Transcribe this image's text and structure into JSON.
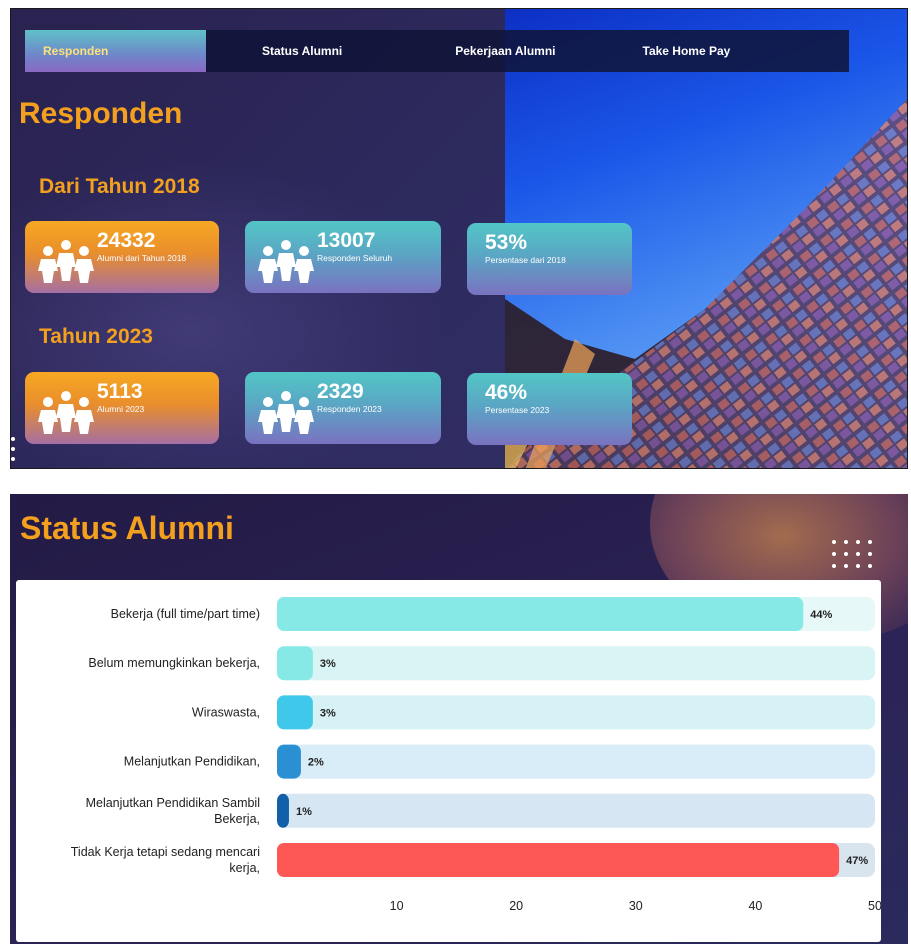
{
  "nav": {
    "items": [
      {
        "label": "Responden",
        "active": true
      },
      {
        "label": "Status Alumni",
        "active": false
      },
      {
        "label": "Pekerjaan Alumni",
        "active": false
      },
      {
        "label": "Take Home Pay",
        "active": false
      }
    ]
  },
  "responden": {
    "title": "Responden",
    "section_2018": {
      "title": "Dari Tahun 2018",
      "cards": [
        {
          "value": "24332",
          "label": "Alumni dari Tahun 2018",
          "icon": "people-icon",
          "color": "#f7a823"
        },
        {
          "value": "13007",
          "label": "Responden Seluruh",
          "icon": "people-icon",
          "color": "#52c6c6"
        },
        {
          "value": "53%",
          "label": "Persentase dari 2018",
          "color": "#52c6c6"
        }
      ]
    },
    "section_2023": {
      "title": "Tahun 2023",
      "cards": [
        {
          "value": "5113",
          "label": "Alumni 2023",
          "icon": "people-icon",
          "color": "#f7a823"
        },
        {
          "value": "2329",
          "label": "Responden 2023",
          "icon": "people-icon",
          "color": "#52c6c6"
        },
        {
          "value": "46%",
          "label": "Persentase 2023",
          "color": "#52c6c6"
        }
      ]
    }
  },
  "status_alumni": {
    "title": "Status Alumni"
  },
  "chart_data": {
    "type": "bar",
    "orientation": "horizontal",
    "categories": [
      "Bekerja (full time/part time)",
      "Belum memungkinkan bekerja,",
      "Wiraswasta,",
      "Melanjutkan Pendidikan,",
      "Melanjutkan Pendidikan Sambil Bekerja,",
      "Tidak Kerja tetapi sedang mencari kerja,"
    ],
    "category_lines": [
      [
        "Bekerja (full time/part time)"
      ],
      [
        "Belum memungkinkan bekerja,"
      ],
      [
        "Wiraswasta,"
      ],
      [
        "Melanjutkan Pendidikan,"
      ],
      [
        "Melanjutkan Pendidikan Sambil",
        "Bekerja,"
      ],
      [
        "Tidak Kerja tetapi sedang mencari",
        "kerja,"
      ]
    ],
    "values": [
      44,
      3,
      3,
      2,
      1,
      47
    ],
    "data_labels": [
      "44%",
      "3%",
      "3%",
      "2%",
      "1%",
      "47%"
    ],
    "bar_colors": [
      "#86e9e6",
      "#86e9e6",
      "#40c8ea",
      "#2b8fd3",
      "#1261a8",
      "#fd5756"
    ],
    "track_colors": [
      "#e6f8f8",
      "#d9f4f5",
      "#d6f2f6",
      "#d8edf8",
      "#d6e6f3",
      "#d8e4ee"
    ],
    "xlim": [
      0,
      50
    ],
    "xticks": [
      10,
      20,
      30,
      40,
      50
    ],
    "grid": false,
    "xlabel": "",
    "ylabel": ""
  }
}
